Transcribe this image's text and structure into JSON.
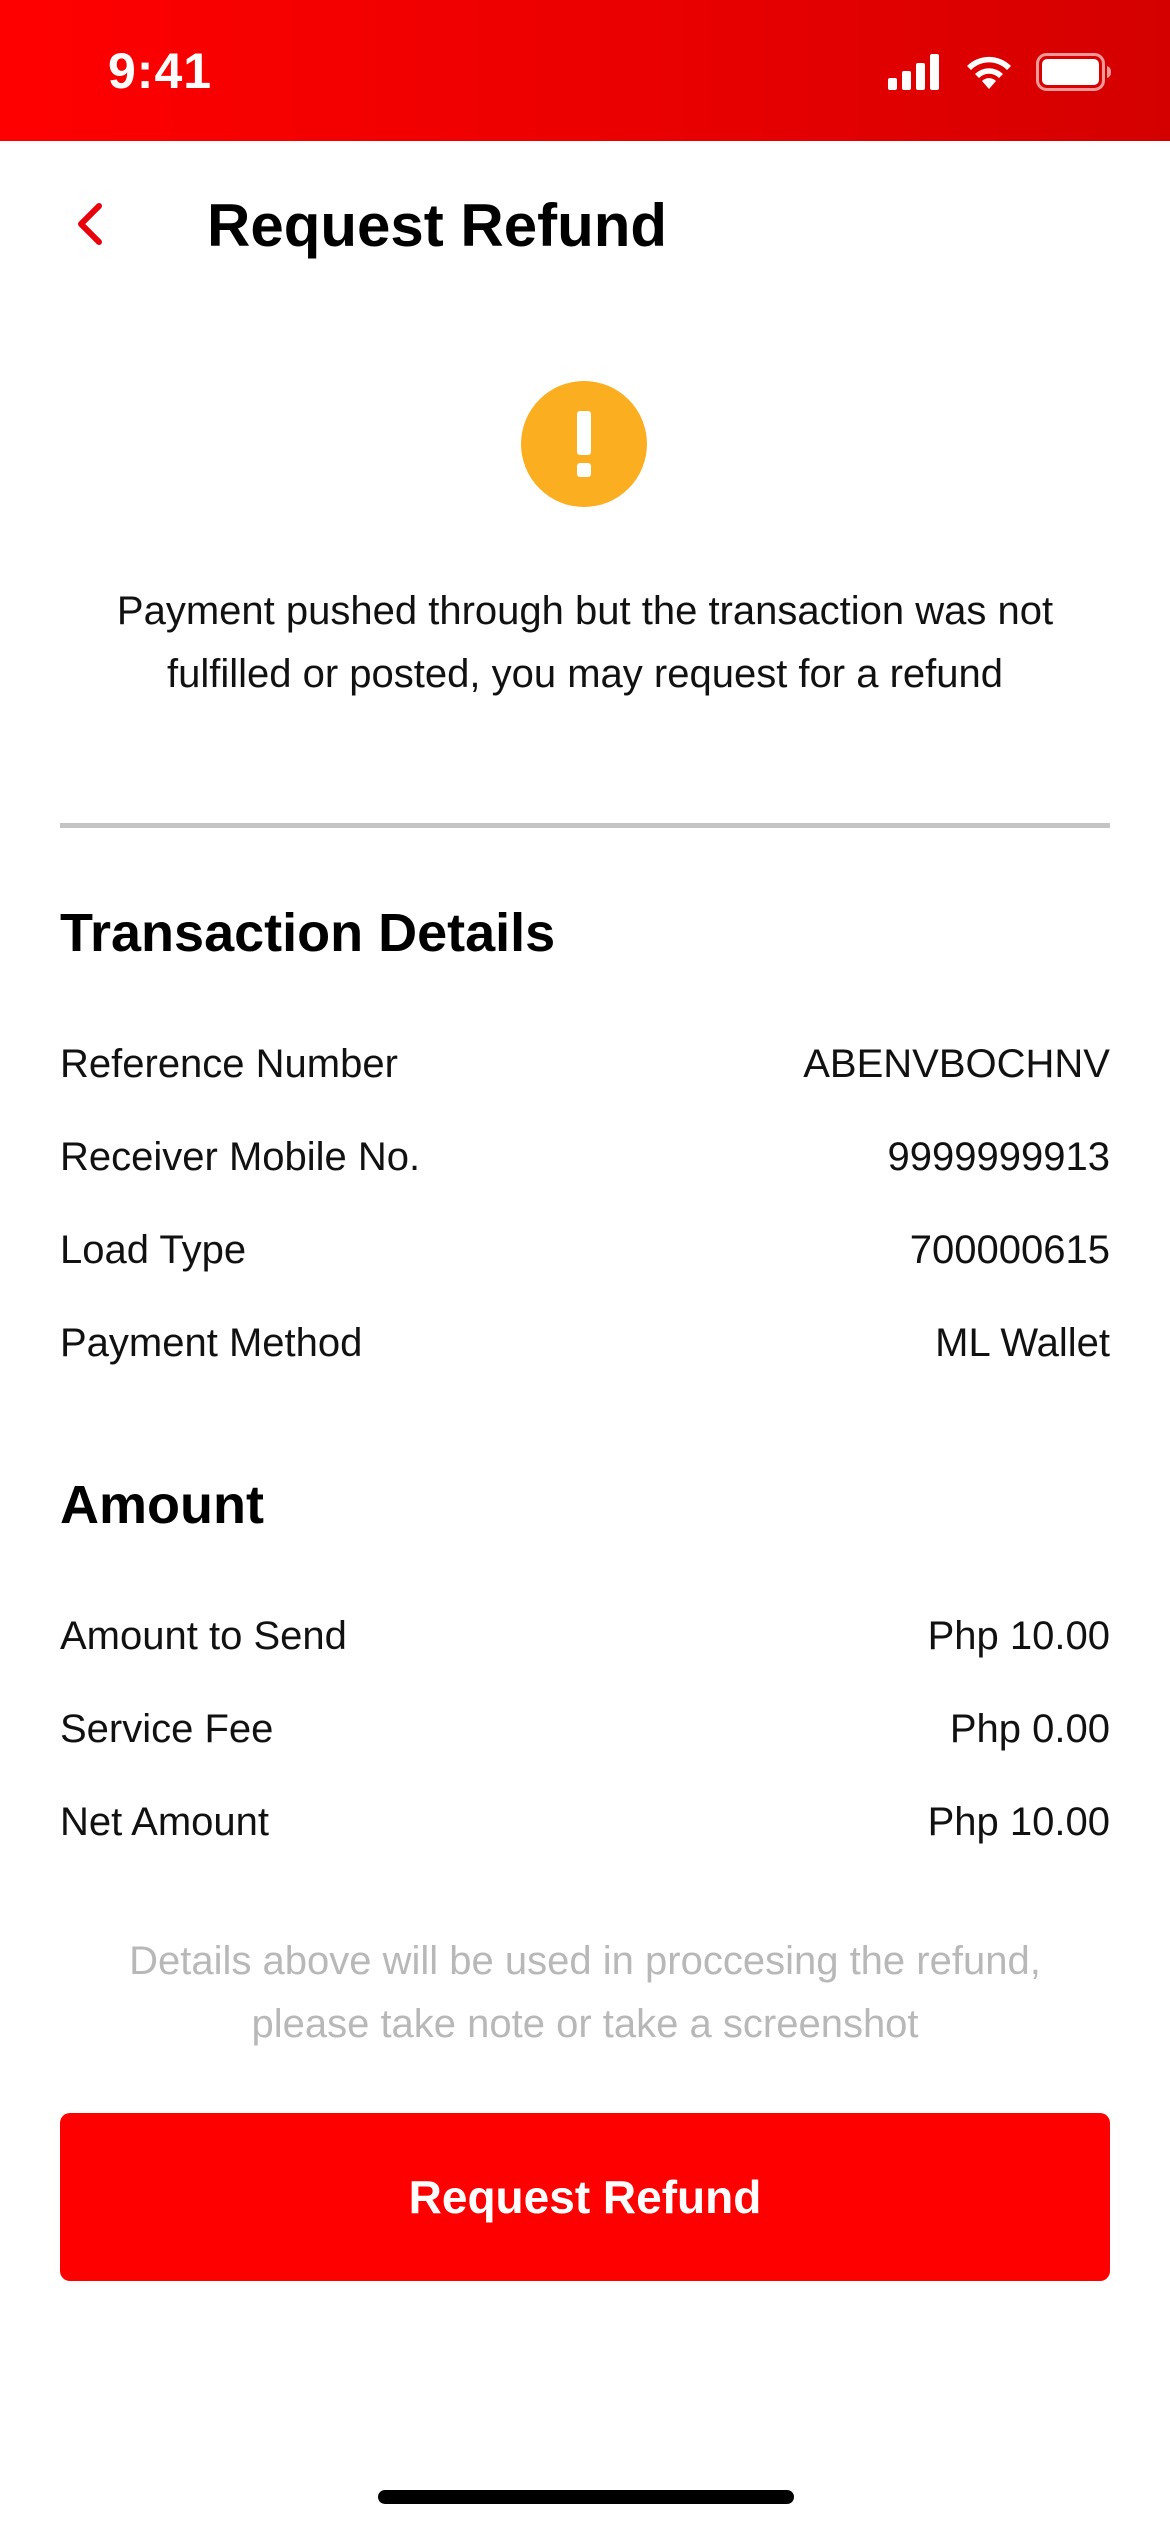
{
  "status_bar": {
    "time": "9:41",
    "icons": [
      "cellular-signal-icon",
      "wifi-icon",
      "battery-icon"
    ],
    "background": "#ff0000"
  },
  "header": {
    "back_icon": "chevron-left-icon",
    "title": "Request Refund"
  },
  "alert": {
    "icon": "exclamation-icon",
    "icon_color": "#fbae1f",
    "message_line1": "Payment pushed through but the transaction was not",
    "message_line2": "fulfilled or posted, you may request for a refund"
  },
  "transaction_details": {
    "title": "Transaction Details",
    "rows": [
      {
        "label": "Reference Number",
        "value": "ABENVBOCHNV"
      },
      {
        "label": "Receiver Mobile No.",
        "value": "9999999913"
      },
      {
        "label": "Load Type",
        "value": "700000615"
      },
      {
        "label": "Payment Method",
        "value": "ML Wallet"
      }
    ]
  },
  "amount": {
    "title": "Amount",
    "rows": [
      {
        "label": "Amount to Send",
        "value": "Php 10.00"
      },
      {
        "label": "Service Fee",
        "value": "Php 0.00"
      },
      {
        "label": "Net Amount",
        "value": "Php 10.00"
      }
    ]
  },
  "note": {
    "line1": "Details above will be used in proccesing the refund,",
    "line2": "please take note or take a screenshot"
  },
  "cta": {
    "label": "Request Refund",
    "color": "#ff0000"
  }
}
